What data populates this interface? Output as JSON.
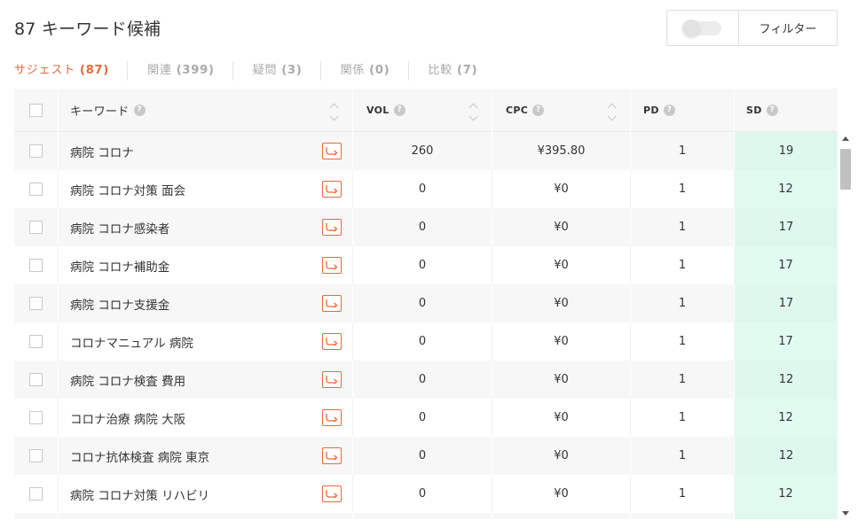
{
  "header": {
    "title": "87 キーワード候補",
    "filter_label": "フィルター"
  },
  "tabs": [
    {
      "label": "サジェスト",
      "count": "(87)",
      "active": true
    },
    {
      "label": "関連",
      "count": "(399)",
      "active": false
    },
    {
      "label": "疑問",
      "count": "(3)",
      "active": false
    },
    {
      "label": "関係",
      "count": "(0)",
      "active": false
    },
    {
      "label": "比較",
      "count": "(7)",
      "active": false
    }
  ],
  "table": {
    "headers": {
      "keyword": "キーワード",
      "vol": "VOL",
      "cpc": "CPC",
      "pd": "PD",
      "sd": "SD",
      "help": "?"
    },
    "rows": [
      {
        "keyword": "病院 コロナ",
        "vol": "260",
        "cpc": "¥395.80",
        "pd": "1",
        "sd": "19"
      },
      {
        "keyword": "病院 コロナ対策 面会",
        "vol": "0",
        "cpc": "¥0",
        "pd": "1",
        "sd": "12"
      },
      {
        "keyword": "病院 コロナ感染者",
        "vol": "0",
        "cpc": "¥0",
        "pd": "1",
        "sd": "17"
      },
      {
        "keyword": "病院 コロナ補助金",
        "vol": "0",
        "cpc": "¥0",
        "pd": "1",
        "sd": "17"
      },
      {
        "keyword": "病院 コロナ支援金",
        "vol": "0",
        "cpc": "¥0",
        "pd": "1",
        "sd": "17"
      },
      {
        "keyword": "コロナマニュアル 病院",
        "vol": "0",
        "cpc": "¥0",
        "pd": "1",
        "sd": "17"
      },
      {
        "keyword": "病院 コロナ検査 費用",
        "vol": "0",
        "cpc": "¥0",
        "pd": "1",
        "sd": "12"
      },
      {
        "keyword": "コロナ治療 病院 大阪",
        "vol": "0",
        "cpc": "¥0",
        "pd": "1",
        "sd": "12"
      },
      {
        "keyword": "コロナ抗体検査 病院 東京",
        "vol": "0",
        "cpc": "¥0",
        "pd": "1",
        "sd": "12"
      },
      {
        "keyword": "病院 コロナ対策 リハビリ",
        "vol": "0",
        "cpc": "¥0",
        "pd": "1",
        "sd": "12"
      },
      {
        "keyword": "",
        "vol": "",
        "cpc": "",
        "pd": "",
        "sd": ""
      }
    ]
  },
  "colors": {
    "accent": "#e8683f",
    "sd_fill": "#dff8ee"
  },
  "icons": {
    "goto": "arrow-right-icon",
    "help": "question-circle-icon",
    "sort": "sort-icon"
  }
}
